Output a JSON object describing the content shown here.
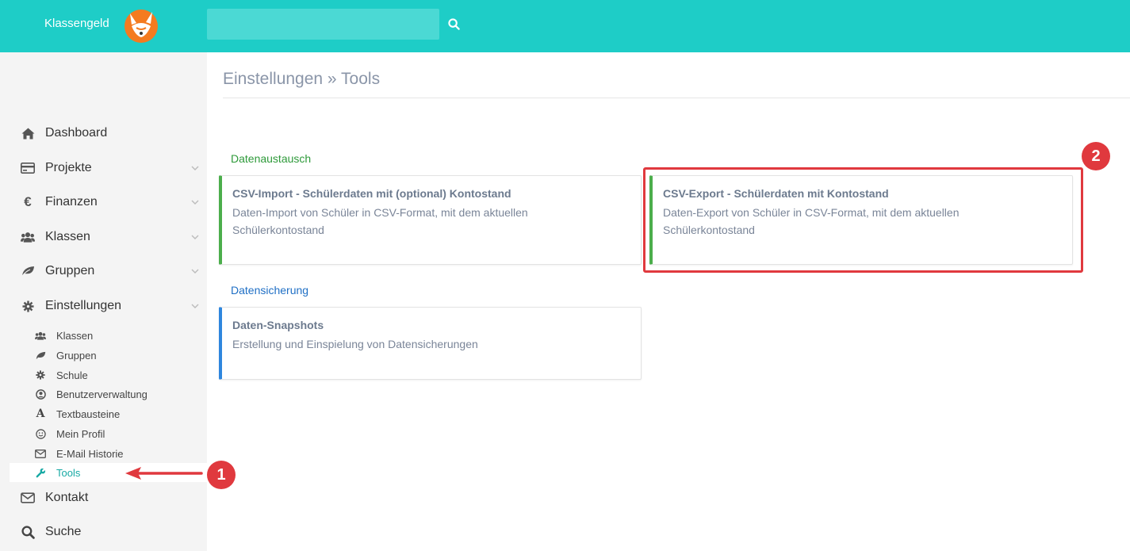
{
  "header": {
    "brand": "Klassengeld",
    "search_placeholder": ""
  },
  "sidebar": {
    "items": [
      {
        "label": "Dashboard",
        "icon": "home-icon"
      },
      {
        "label": "Projekte",
        "icon": "credit-card-icon"
      },
      {
        "label": "Finanzen",
        "icon": "euro-icon"
      },
      {
        "label": "Klassen",
        "icon": "users-icon"
      },
      {
        "label": "Gruppen",
        "icon": "leaf-icon"
      },
      {
        "label": "Einstellungen",
        "icon": "gear-icon"
      }
    ],
    "sub_items": [
      {
        "label": "Klassen",
        "icon": "users-icon"
      },
      {
        "label": "Gruppen",
        "icon": "leaf-icon"
      },
      {
        "label": "Schule",
        "icon": "gear-icon"
      },
      {
        "label": "Benutzerverwaltung",
        "icon": "user-circle-icon"
      },
      {
        "label": "Textbausteine",
        "icon": "font-icon"
      },
      {
        "label": "Mein Profil",
        "icon": "smile-icon"
      },
      {
        "label": "E-Mail Historie",
        "icon": "envelope-icon"
      },
      {
        "label": "Tools",
        "icon": "wrench-icon",
        "active": true
      }
    ],
    "bottom_items": [
      {
        "label": "Kontakt",
        "icon": "envelope-icon"
      },
      {
        "label": "Suche",
        "icon": "search-icon"
      }
    ]
  },
  "main": {
    "title": "Einstellungen » Tools",
    "sections": [
      {
        "heading": "Datenaustausch",
        "color": "#2e9a3a",
        "cards": [
          {
            "title": "CSV-Import - Schülerdaten mit (optional) Kontostand",
            "description": "Daten-Import von Schüler in CSV-Format, mit dem aktuellen Schülerkontostand"
          },
          {
            "title": "CSV-Export - Schülerdaten mit Kontostand",
            "description": "Daten-Export von Schüler in CSV-Format, mit dem aktuellen Schülerkontostand"
          }
        ]
      },
      {
        "heading": "Datensicherung",
        "color": "#1f6fc5",
        "cards": [
          {
            "title": "Daten-Snapshots",
            "description": "Erstellung und Einspielung von Datensicherungen"
          }
        ]
      }
    ]
  },
  "annotations": {
    "badge_1": "1",
    "badge_2": "2",
    "color": "#e0393e"
  },
  "colors": {
    "topbar": "#1ecdc7",
    "accent": "#17a9a4",
    "green": "#4cae4c",
    "blue": "#2e86de"
  }
}
